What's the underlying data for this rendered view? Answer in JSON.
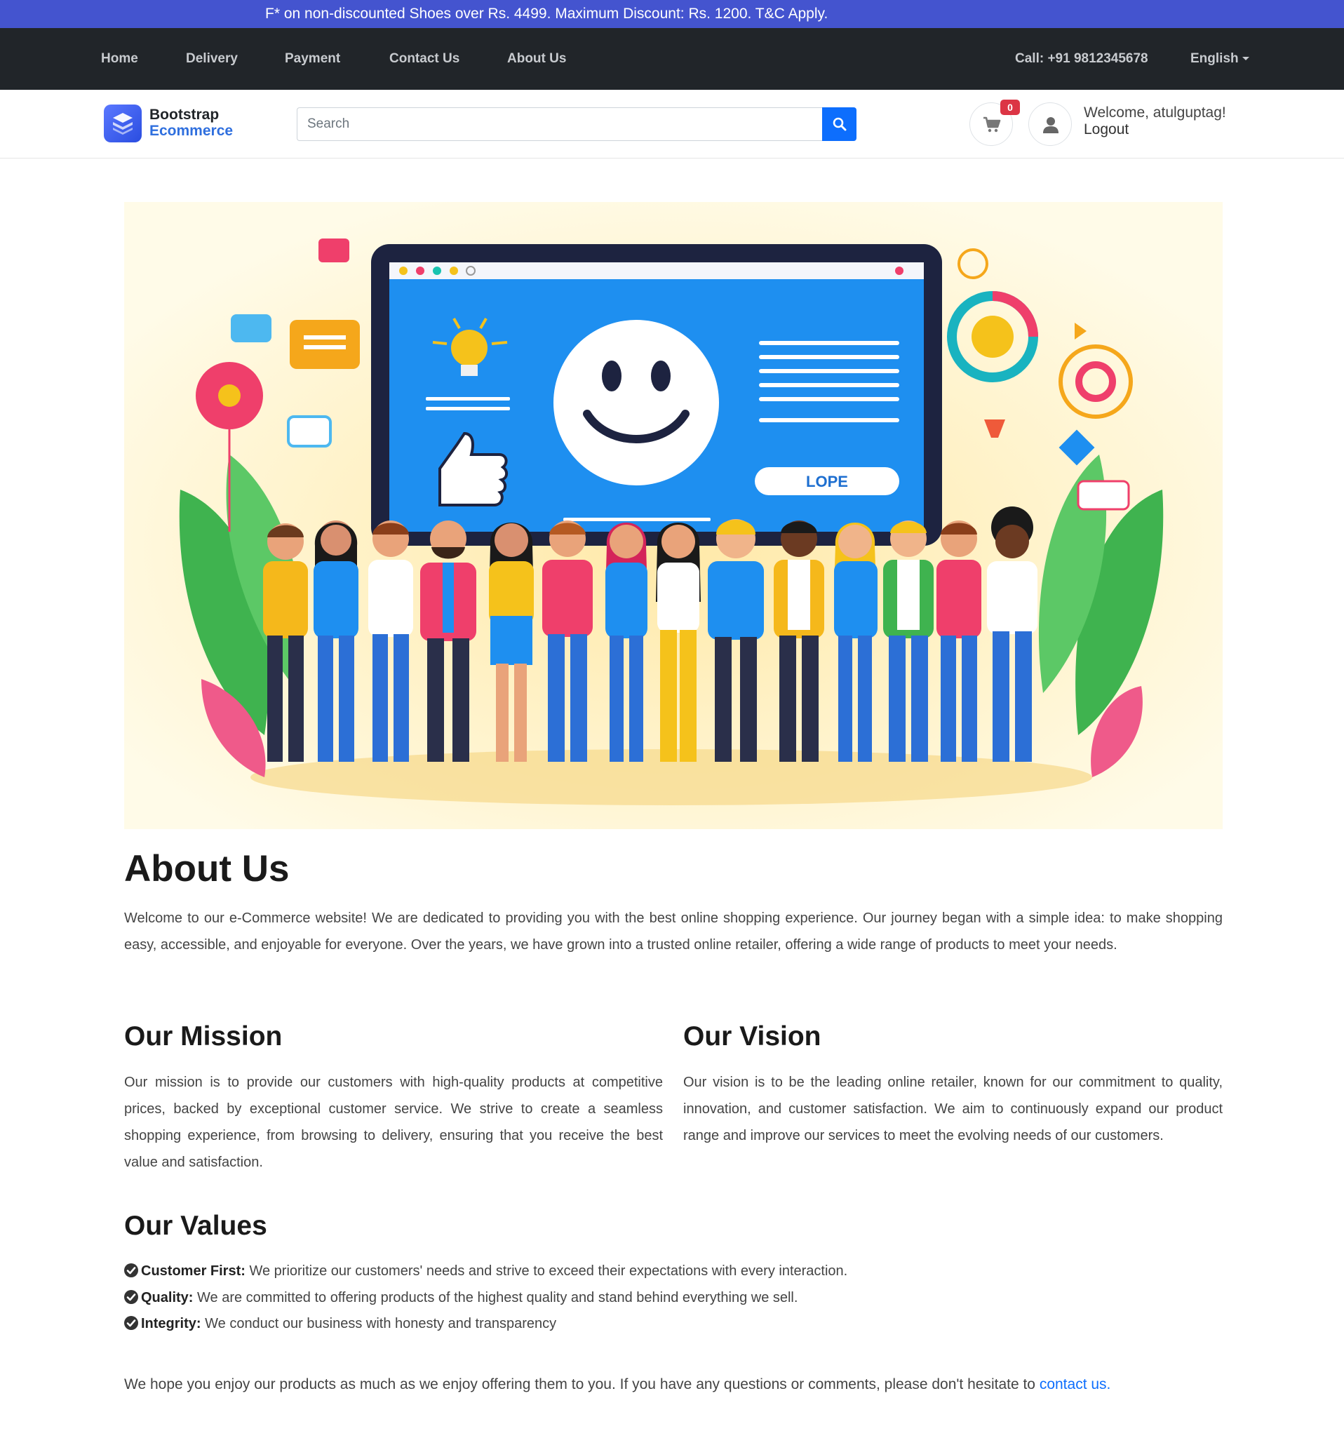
{
  "promo": {
    "text": "F* on non-discounted Shoes over Rs. 4499. Maximum Discount: Rs. 1200. T&C Apply."
  },
  "topnav": {
    "items": [
      {
        "label": "Home"
      },
      {
        "label": "Delivery"
      },
      {
        "label": "Payment"
      },
      {
        "label": "Contact Us"
      },
      {
        "label": "About Us"
      }
    ],
    "call": "Call: +91 9812345678",
    "language": "English"
  },
  "header": {
    "logo_line1": "Bootstrap",
    "logo_line2": "Ecommerce",
    "search_placeholder": "Search",
    "search_value": "",
    "cart_count": "0",
    "welcome": "Welcome, atulguptag!",
    "logout": "Logout"
  },
  "hero": {
    "screen_button_text": "LOPE"
  },
  "content": {
    "title": "About Us",
    "intro": "Welcome to our e-Commerce website! We are dedicated to providing you with the best online shopping experience. Our journey began with a simple idea: to make shopping easy, accessible, and enjoyable for everyone. Over the years, we have grown into a trusted online retailer, offering a wide range of products to meet your needs.",
    "mission_title": "Our Mission",
    "mission_text": "Our mission is to provide our customers with high-quality products at competitive prices, backed by exceptional customer service. We strive to create a seamless shopping experience, from browsing to delivery, ensuring that you receive the best value and satisfaction.",
    "vision_title": "Our Vision",
    "vision_text": "Our vision is to be the leading online retailer, known for our commitment to quality, innovation, and customer satisfaction. We aim to continuously expand our product range and improve our services to meet the evolving needs of our customers.",
    "values_title": "Our Values",
    "values": [
      {
        "name": "Customer First:",
        "text": " We prioritize our customers' needs and strive to exceed their expectations with every interaction."
      },
      {
        "name": "Quality:",
        "text": " We are committed to offering products of the highest quality and stand behind everything we sell."
      },
      {
        "name": "Integrity:",
        "text": " We conduct our business with honesty and transparency"
      }
    ],
    "closing_text": "We hope you enjoy our products as much as we enjoy offering them to you. If you have any questions or comments, please don't hesitate to ",
    "closing_link": "contact us."
  },
  "colors": {
    "promo_bg": "#4454cf",
    "nav_bg": "#212529",
    "primary": "#0d6efd",
    "badge": "#dc3545",
    "hero_bg": "#fffbe8",
    "screen_blue": "#1e8ff0"
  }
}
